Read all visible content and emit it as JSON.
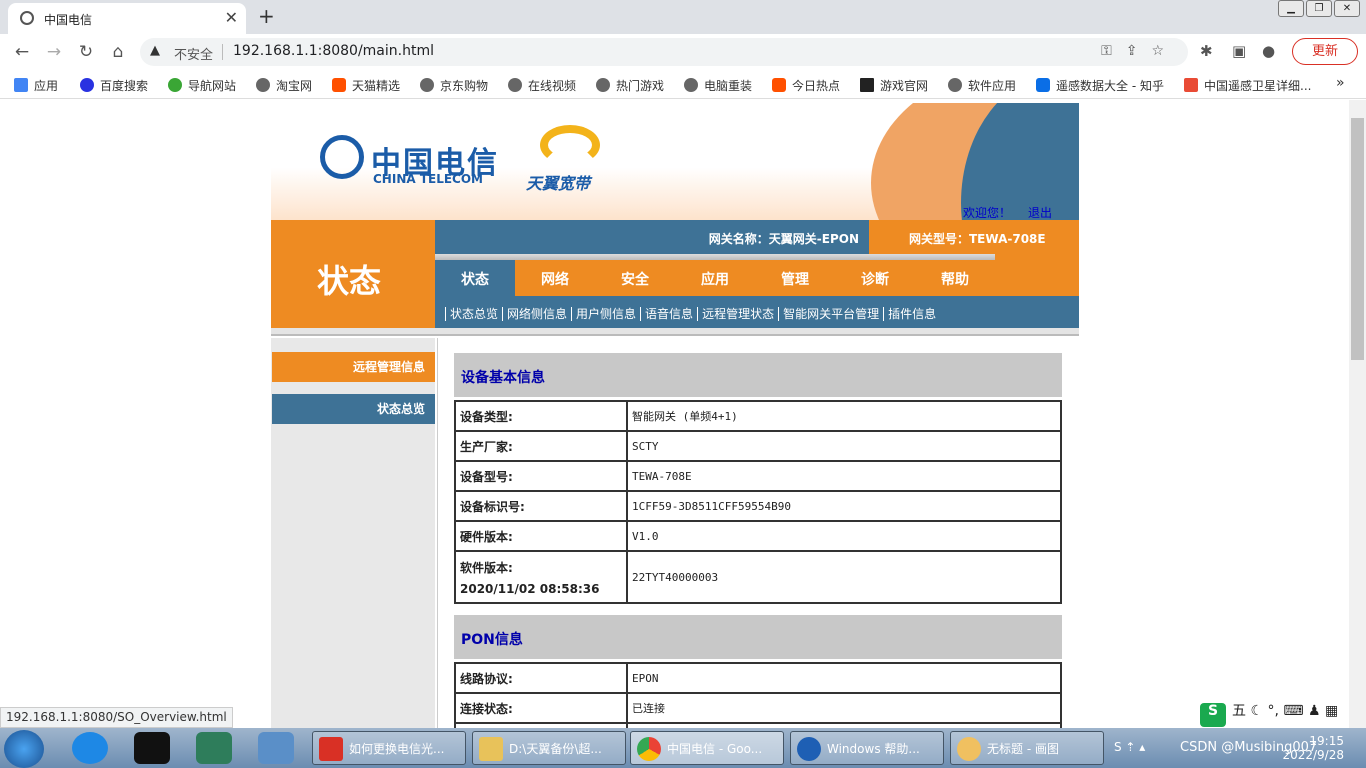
{
  "browser": {
    "tab_title": "中国电信",
    "tab_close": "✕",
    "new_tab": "+",
    "insecure_label": "不安全",
    "url": "192.168.1.1:8080/main.html",
    "update_label": "更新",
    "status_url": "192.168.1.1:8080/SO_Overview.html"
  },
  "bookmarks": [
    {
      "label": "应用"
    },
    {
      "label": "百度搜索"
    },
    {
      "label": "导航网站"
    },
    {
      "label": "淘宝网"
    },
    {
      "label": "天猫精选"
    },
    {
      "label": "京东购物"
    },
    {
      "label": "在线视频"
    },
    {
      "label": "热门游戏"
    },
    {
      "label": "电脑重装"
    },
    {
      "label": "今日热点"
    },
    {
      "label": "游戏官网"
    },
    {
      "label": "软件应用"
    },
    {
      "label": "遥感数据大全 - 知乎"
    },
    {
      "label": "中国遥感卫星详细..."
    }
  ],
  "header": {
    "logo_cn": "中国电信",
    "logo_en": "CHINA TELECOM",
    "broadband": "天翼宽带",
    "welcome": "欢迎您！",
    "logout": "退出",
    "section_title": "状态",
    "gateway_name": "网关名称：天翼网关-EPON",
    "gateway_model": "网关型号：TEWA-708E"
  },
  "nav": {
    "tabs": [
      "状态",
      "网络",
      "安全",
      "应用",
      "管理",
      "诊断",
      "帮助"
    ],
    "subnav": [
      "状态总览",
      "网络侧信息",
      "用户侧信息",
      "语音信息",
      "远程管理状态",
      "智能网关平台管理",
      "插件信息"
    ]
  },
  "sidebar": {
    "items": [
      "远程管理信息",
      "状态总览"
    ]
  },
  "device_info": {
    "title": "设备基本信息",
    "rows": [
      {
        "key": "设备类型:",
        "value": "智能网关 (单频4+1)"
      },
      {
        "key": "生产厂家:",
        "value": "SCTY"
      },
      {
        "key": "设备型号:",
        "value": "TEWA-708E"
      },
      {
        "key": "设备标识号:",
        "value": "1CFF59-3D8511CFF59554B90"
      },
      {
        "key": "硬件版本:",
        "value": "V1.0"
      },
      {
        "key": "软件版本:",
        "key2": "2020/11/02 08:58:36",
        "value": "22TYT40000003"
      }
    ]
  },
  "pon_info": {
    "title": "PON信息",
    "rows": [
      {
        "key": "线路协议:",
        "value": "EPON"
      },
      {
        "key": "连接状态:",
        "value": "已连接"
      }
    ]
  },
  "taskbar": {
    "tasks": [
      {
        "label": "如何更换电信光..."
      },
      {
        "label": "D:\\天翼备份\\超..."
      },
      {
        "label": "中国电信 - Goo..."
      },
      {
        "label": "Windows 帮助..."
      },
      {
        "label": "无标题 - 画图"
      }
    ],
    "time": "19:15",
    "date": "2022/9/28",
    "ime_label": "五",
    "ime_logo": "S",
    "watermark": "CSDN @Musibing007"
  },
  "colors": {
    "orange": "#ee8b22",
    "blue": "#3e7296",
    "grey": "#c8c8c8"
  }
}
